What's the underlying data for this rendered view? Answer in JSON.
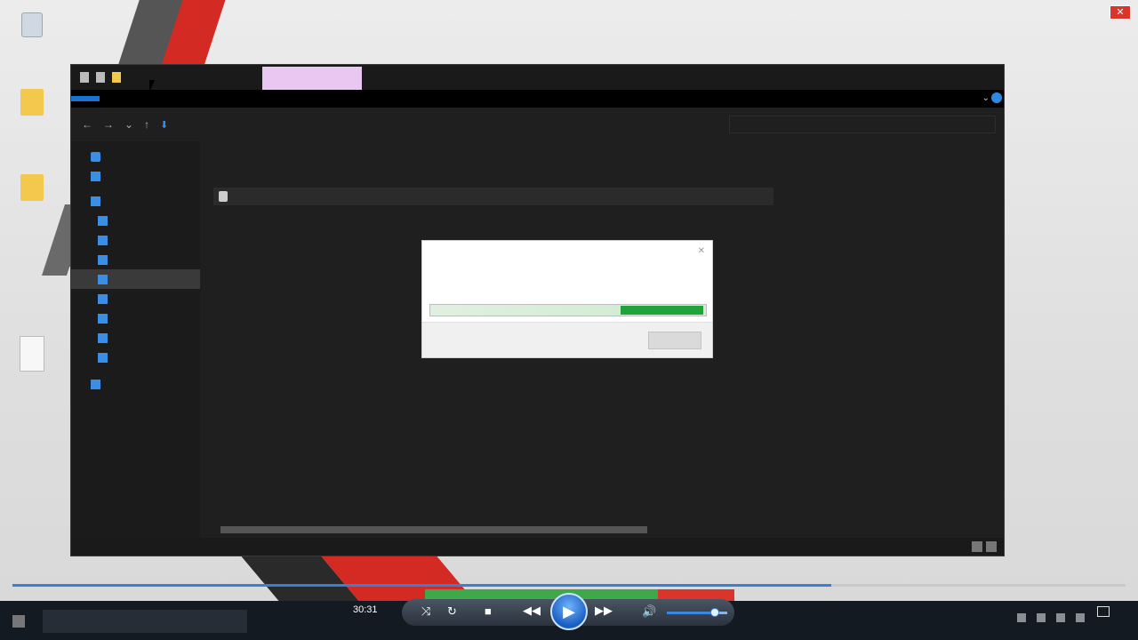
{
  "player": {
    "elapsed_time": "30:31",
    "close_label": "✕",
    "progress": 0.736,
    "volume": 0.8,
    "colors": {
      "seek_played": "#3a7fd6",
      "play_button": "#1a5fc0",
      "green_bar": "#3ea84a",
      "red_bar": "#d9352b"
    }
  },
  "explorer": {
    "dialog": {
      "progress": 0.31,
      "fill_color": "#1fa33a"
    }
  }
}
